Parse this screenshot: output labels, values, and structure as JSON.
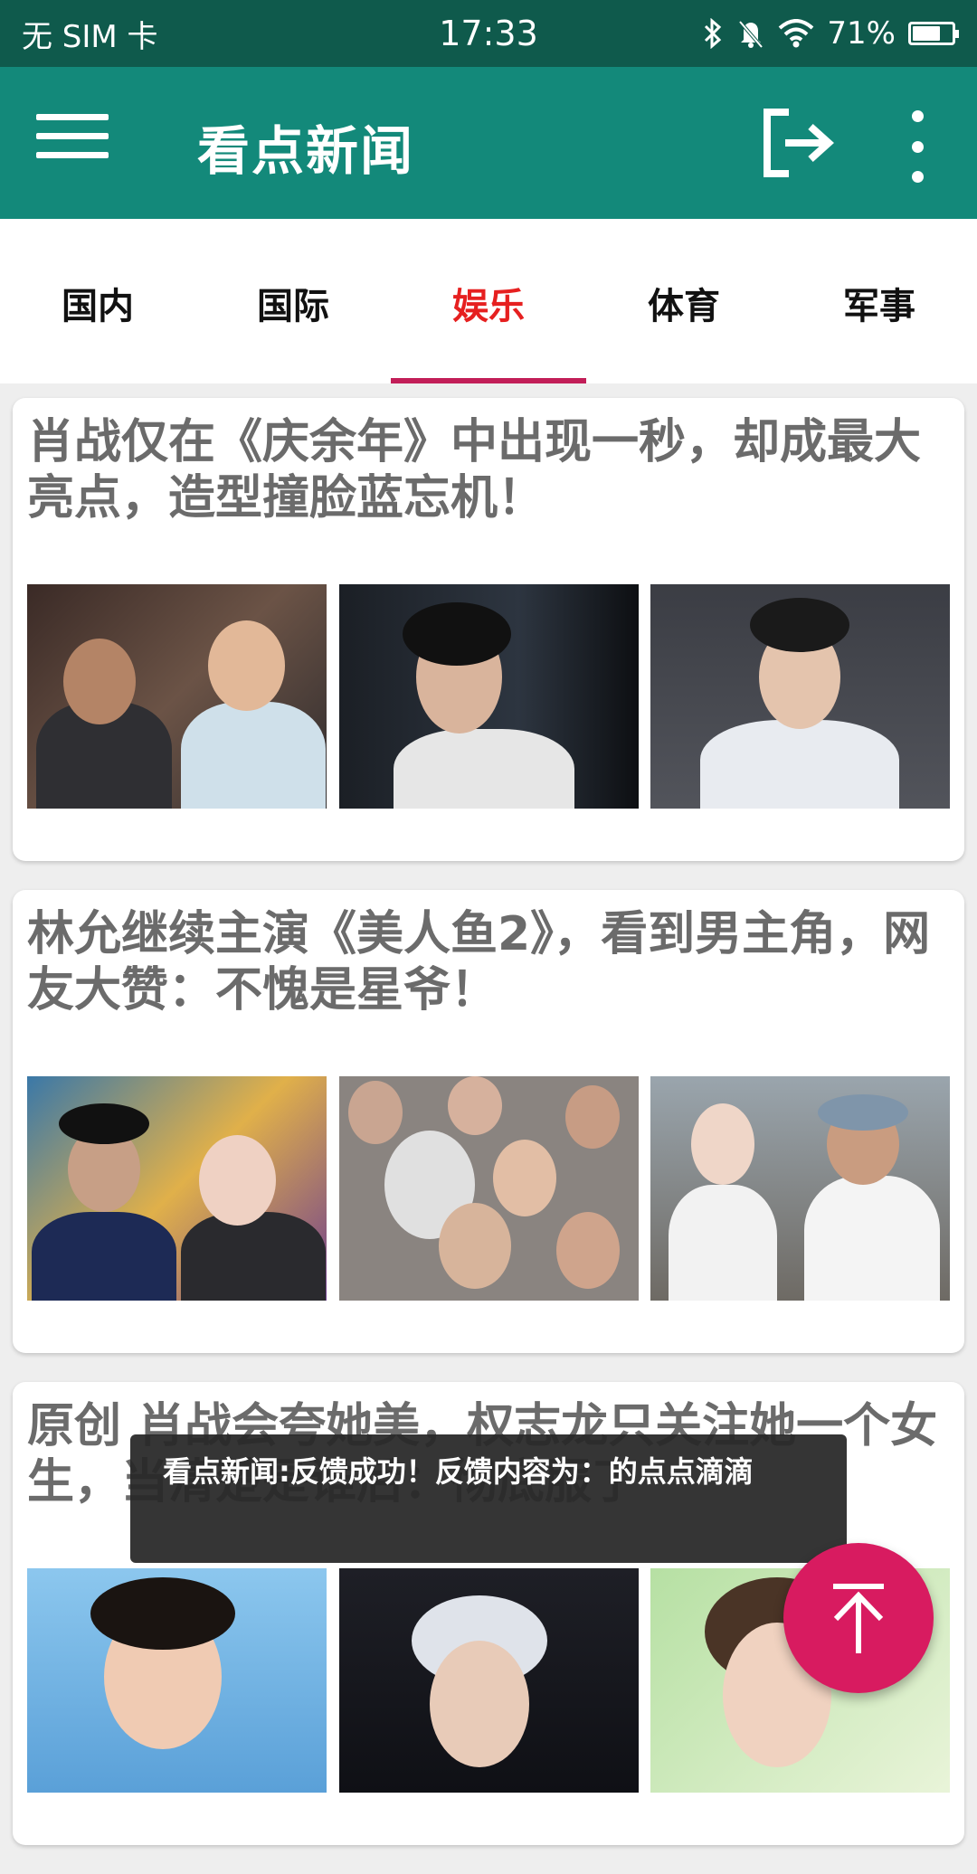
{
  "status_bar": {
    "carrier": "无 SIM 卡",
    "time": "17:33",
    "battery": "71%",
    "battery_level": 0.71
  },
  "app_bar": {
    "title": "看点新闻",
    "menu_icon": "hamburger-menu-icon",
    "logout_icon": "logout-icon",
    "more_icon": "more-vert-icon"
  },
  "tabs": [
    {
      "label": "国内",
      "active": false
    },
    {
      "label": "国际",
      "active": false
    },
    {
      "label": "娱乐",
      "active": true
    },
    {
      "label": "体育",
      "active": false
    },
    {
      "label": "军事",
      "active": false
    }
  ],
  "articles": [
    {
      "title": "肖战仅在《庆余年》中出现一秒，却成最大亮点，造型撞脸蓝忘机！"
    },
    {
      "title": "林允继续主演《美人鱼2》，看到男主角，网友大赞：不愧是星爷！"
    },
    {
      "title": "原创 肖战会夸她美，权志龙只关注她一个女生，当清楚是谁后：彻底服了"
    }
  ],
  "toast": {
    "message": "看点新闻:反馈成功！反馈内容为：的点点滴滴"
  },
  "fab": {
    "icon": "arrow-up-to-top-icon"
  },
  "colors": {
    "status_bar": "#0f5a4c",
    "app_bar": "#13897a",
    "active_tab": "#e62020",
    "indicator": "#c21e58",
    "fab": "#d81b60"
  }
}
